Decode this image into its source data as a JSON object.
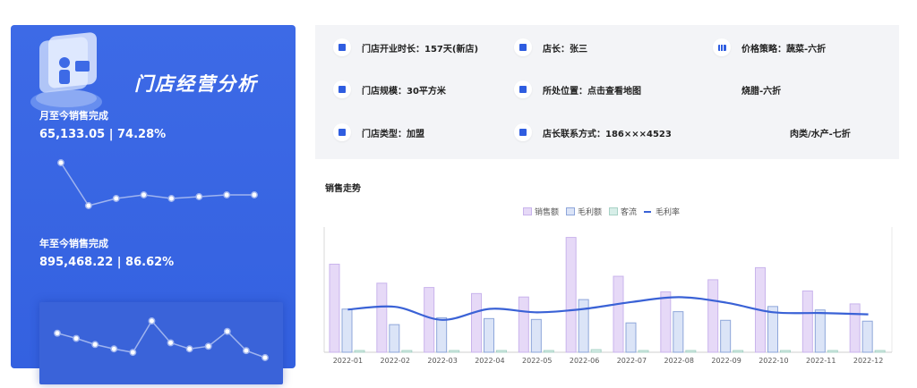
{
  "panel": {
    "title": "门店经营分析",
    "monthly": {
      "label": "月至今销售完成",
      "value": "65,133.05 | 74.28%",
      "trend": [
        100,
        52,
        60,
        64,
        60,
        62,
        64,
        64
      ]
    },
    "yearly": {
      "label": "年至今销售完成",
      "value": "895,468.22 | 86.62%",
      "trend": [
        58,
        52,
        45,
        40,
        36,
        72,
        47,
        40,
        43,
        60,
        38,
        30
      ]
    },
    "colors": {
      "bg": "#3461e0",
      "line": "#9fb4ef",
      "point": "#ffffff"
    }
  },
  "info": [
    {
      "icon": "store-icon",
      "label": "门店开业时长：157天(新店)"
    },
    {
      "icon": "user-icon",
      "label": "店长：张三"
    },
    {
      "icon": "price-icon",
      "label": "价格策略：蔬菜-六折"
    },
    {
      "icon": "area-icon",
      "label": "门店规模：30平方米"
    },
    {
      "icon": "location-icon",
      "label": "所处位置：点击查看地图"
    },
    {
      "icon": "",
      "label": "烧腊-六折"
    },
    {
      "icon": "type-icon",
      "label": "门店类型：加盟"
    },
    {
      "icon": "phone-icon",
      "label": "店长联系方式：186×××4523"
    },
    {
      "icon": "",
      "label": "肉类/水产-七折"
    }
  ],
  "sales": {
    "title": "销售走势",
    "legend": [
      "销售额",
      "毛利额",
      "客流",
      "毛利率"
    ],
    "colors": {
      "sales": "#e6d9f7",
      "salesBorder": "#c9b4ec",
      "profit": "#dbe4f7",
      "profitBorder": "#8ea6da",
      "traffic": "#d7eee8",
      "trafficBorder": "#a8d2c6",
      "rate": "#3a62d6"
    },
    "chart_data": {
      "type": "bar",
      "categories": [
        "2022-01",
        "2022-02",
        "2022-03",
        "2022-04",
        "2022-05",
        "2022-06",
        "2022-07",
        "2022-08",
        "2022-09",
        "2022-10",
        "2022-11",
        "2022-12"
      ],
      "series": [
        {
          "name": "销售额",
          "values": [
            102,
            80,
            75,
            68,
            64,
            133,
            88,
            70,
            84,
            98,
            71,
            56
          ]
        },
        {
          "name": "毛利额",
          "values": [
            50,
            32,
            40,
            39,
            38,
            61,
            34,
            47,
            37,
            53,
            49,
            36
          ]
        },
        {
          "name": "客流",
          "values": [
            2,
            2,
            2,
            2,
            2,
            3,
            2,
            2,
            2,
            2,
            2,
            2
          ]
        },
        {
          "name": "毛利率",
          "values": [
            0.62,
            0.66,
            0.47,
            0.63,
            0.58,
            0.63,
            0.73,
            0.8,
            0.72,
            0.58,
            0.57,
            0.55
          ]
        }
      ],
      "ylim": [
        0,
        145
      ]
    }
  }
}
